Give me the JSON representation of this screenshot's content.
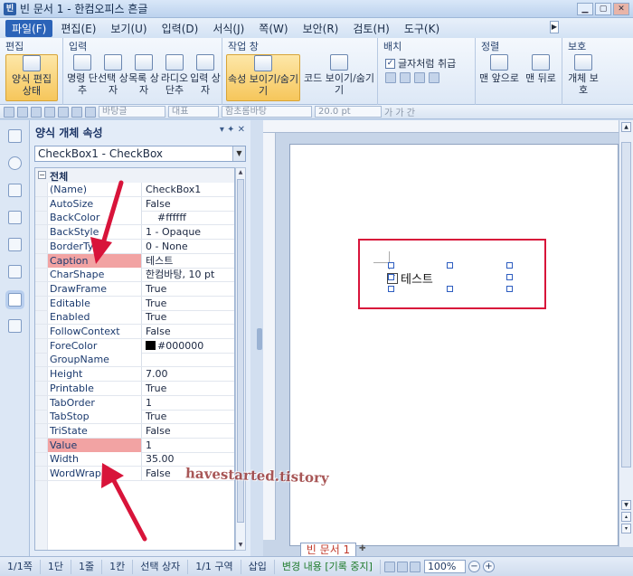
{
  "window": {
    "title": "빈 문서 1 - 한컴오피스 흔글",
    "icon": "hwp-app-icon"
  },
  "menu": [
    {
      "label": "파일(F)",
      "active": true
    },
    {
      "label": "편집(E)"
    },
    {
      "label": "보기(U)"
    },
    {
      "label": "입력(D)"
    },
    {
      "label": "서식(J)"
    },
    {
      "label": "쪽(W)"
    },
    {
      "label": "보안(R)"
    },
    {
      "label": "검토(H)"
    },
    {
      "label": "도구(K)"
    }
  ],
  "ribbon": {
    "groups": {
      "edit": "편집",
      "input": "입력",
      "window": "작업 창",
      "layout": "배치",
      "order": "정렬",
      "protect": "보호"
    },
    "buttons": {
      "form_edit": "양식 편집 상태",
      "command_button": "명령 단추",
      "select_box": "선택 상자",
      "list_box": "목록 상자",
      "radio_button": "라디오 단추",
      "input_box": "입력 상자",
      "properties": "속성 보이기/숨기기",
      "code": "코드 보이기/숨기기",
      "bring_front": "맨 앞으로",
      "send_back": "맨 뒤로",
      "protect_obj": "개체 보호"
    },
    "treat_as_char": "글자처럼 취급"
  },
  "toolbar": {
    "style_combo": "바탕글",
    "para_combo": "대표",
    "font_combo": "함초롬바탕",
    "size_combo": "20.0 pt",
    "bold_italic": "가 가 간"
  },
  "panel": {
    "title": "양식 개체 속성",
    "controls": "▾ ✦ ✕",
    "object": "CheckBox1 - CheckBox",
    "category": "전체",
    "properties": [
      {
        "k": "(Name)",
        "v": "CheckBox1"
      },
      {
        "k": "AutoSize",
        "v": "False"
      },
      {
        "k": "BackColor",
        "v": "#ffffff",
        "swatch": "#ffffff"
      },
      {
        "k": "BackStyle",
        "v": "1 - Opaque"
      },
      {
        "k": "BorderType",
        "v": "0 - None"
      },
      {
        "k": "Caption",
        "v": "테스트",
        "hl": true
      },
      {
        "k": "CharShape",
        "v": "한컴바탕, 10 pt"
      },
      {
        "k": "DrawFrame",
        "v": "True"
      },
      {
        "k": "Editable",
        "v": "True"
      },
      {
        "k": "Enabled",
        "v": "True"
      },
      {
        "k": "FollowContext",
        "v": "False"
      },
      {
        "k": "ForeColor",
        "v": "#000000",
        "swatch": "#000000"
      },
      {
        "k": "GroupName",
        "v": ""
      },
      {
        "k": "Height",
        "v": "7.00"
      },
      {
        "k": "Printable",
        "v": "True"
      },
      {
        "k": "TabOrder",
        "v": "1"
      },
      {
        "k": "TabStop",
        "v": "True"
      },
      {
        "k": "TriState",
        "v": "False"
      },
      {
        "k": "Value",
        "v": "1",
        "hl": true
      },
      {
        "k": "Width",
        "v": "35.00"
      },
      {
        "k": "WordWrap",
        "v": "False"
      }
    ]
  },
  "document": {
    "checkbox_caption": "테스트",
    "tab_label": "빈 문서 1"
  },
  "status": {
    "page": "1/1쪽",
    "section": "1단",
    "line": "1줄",
    "col": "1칸",
    "mode": "선택 상자",
    "area": "1/1 구역",
    "insert": "삽입",
    "track": "변경 내용 [기록 중지]",
    "zoom": "100%"
  },
  "watermark": "havestarted.tistory",
  "colors": {
    "accent": "#2b63b8",
    "highlight": "#f2a3a3",
    "annotation": "#d8143a"
  }
}
